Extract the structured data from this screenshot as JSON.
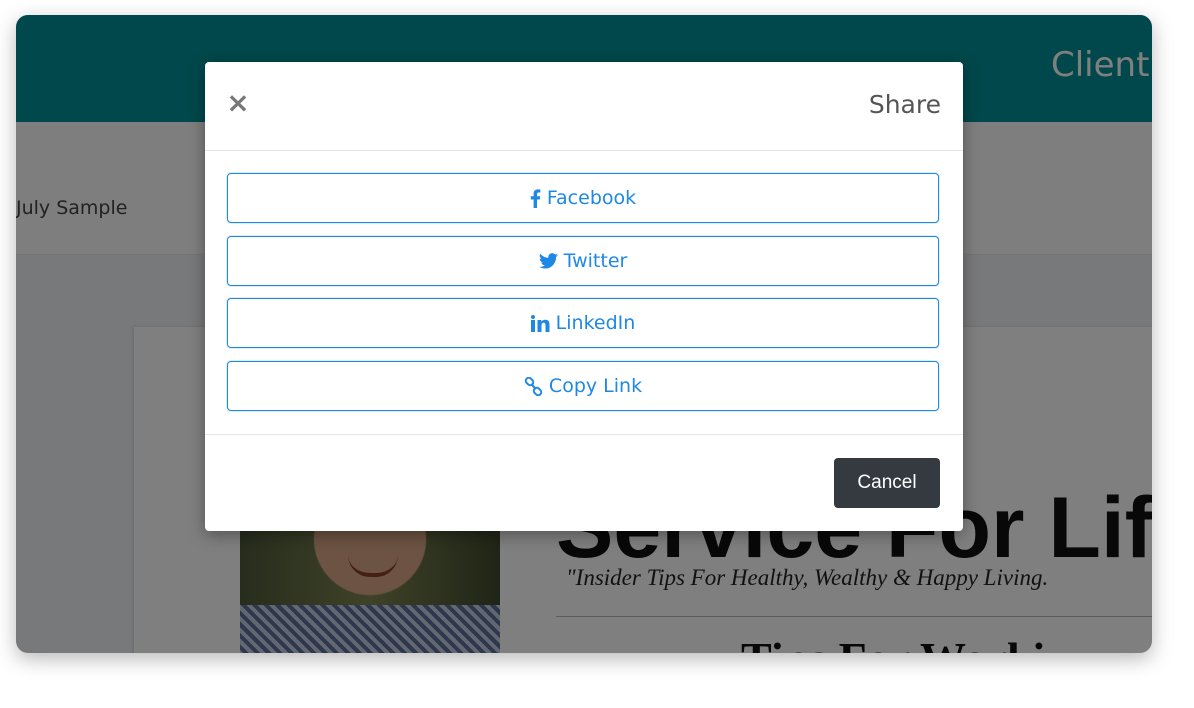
{
  "background": {
    "brand_text": "Client",
    "breadcrumb": "July Sample",
    "newsletter": {
      "headline": "Service For Lif",
      "tagline": "\"Insider Tips For Healthy, Wealthy & Happy Living.",
      "subhead": "Tips For Worki"
    }
  },
  "modal": {
    "title": "Share",
    "close_icon": "close-icon",
    "buttons": [
      {
        "label": "Facebook",
        "icon": "facebook-icon"
      },
      {
        "label": "Twitter",
        "icon": "twitter-icon"
      },
      {
        "label": "LinkedIn",
        "icon": "linkedin-icon"
      },
      {
        "label": "Copy Link",
        "icon": "link-icon"
      }
    ],
    "cancel_label": "Cancel"
  },
  "colors": {
    "header_teal": "#019196",
    "accent_blue": "#1e88e5",
    "cancel_dark": "#343a40"
  }
}
